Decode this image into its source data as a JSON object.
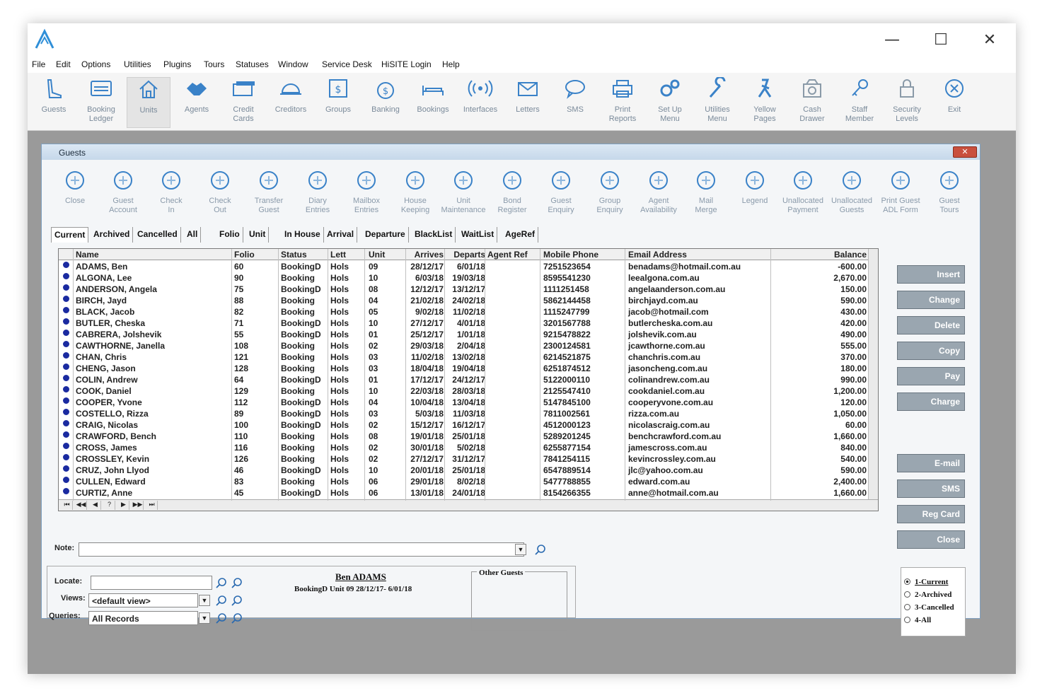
{
  "window": {
    "minimize": "—",
    "maximize": "☐",
    "close": "✕"
  },
  "menu": [
    "File",
    "Edit",
    "Options",
    "Utilities",
    "Plugins",
    "Tours",
    "Statuses",
    "Window",
    "Service Desk",
    "HiSITE Login",
    "Help"
  ],
  "toolbar": [
    {
      "label": "Guests",
      "icon": "guests-icon"
    },
    {
      "label": "Booking\nLedger",
      "icon": "ledger-icon"
    },
    {
      "label": "Units",
      "icon": "home-icon"
    },
    {
      "label": "Agents",
      "icon": "handshake-icon"
    },
    {
      "label": "Credit\nCards",
      "icon": "credit-card-icon"
    },
    {
      "label": "Creditors",
      "icon": "helmet-icon"
    },
    {
      "label": "Groups",
      "icon": "dollar-box-icon"
    },
    {
      "label": "Banking",
      "icon": "money-bag-icon"
    },
    {
      "label": "Bookings",
      "icon": "bed-icon"
    },
    {
      "label": "Interfaces",
      "icon": "broadcast-icon"
    },
    {
      "label": "Letters",
      "icon": "envelope-icon"
    },
    {
      "label": "SMS",
      "icon": "speech-bubble-icon"
    },
    {
      "label": "Print\nReports",
      "icon": "printer-icon"
    },
    {
      "label": "Set Up\nMenu",
      "icon": "gears-icon"
    },
    {
      "label": "Utilities\nMenu",
      "icon": "wrench-icon"
    },
    {
      "label": "Yellow\nPages",
      "icon": "walking-icon"
    },
    {
      "label": "Cash\nDrawer",
      "icon": "cash-drawer-icon"
    },
    {
      "label": "Staff\nMember",
      "icon": "key-icon"
    },
    {
      "label": "Security\nLevels",
      "icon": "lock-icon"
    },
    {
      "label": "Exit",
      "icon": "exit-circle-icon"
    }
  ],
  "guests": {
    "title": "Guests",
    "close_label": "✕",
    "toolbar": [
      {
        "label": "Close",
        "icon": "close-icon"
      },
      {
        "label": "Guest\nAccount",
        "icon": "guest-account-icon"
      },
      {
        "label": "Check\nIn",
        "icon": "check-in-icon"
      },
      {
        "label": "Check\nOut",
        "icon": "check-out-icon"
      },
      {
        "label": "Transfer\nGuest",
        "icon": "transfer-icon"
      },
      {
        "label": "Diary\nEntries",
        "icon": "diary-icon"
      },
      {
        "label": "Mailbox\nEntries",
        "icon": "mailbox-icon"
      },
      {
        "label": "House\nKeeping",
        "icon": "broom-icon"
      },
      {
        "label": "Unit\nMaintenance",
        "icon": "tools-icon"
      },
      {
        "label": "Bond\nRegister",
        "icon": "piggy-bank-icon"
      },
      {
        "label": "Guest\nEnquiry",
        "icon": "question-icon"
      },
      {
        "label": "Group\nEnquiry",
        "icon": "group-icon"
      },
      {
        "label": "Agent\nAvailability",
        "icon": "agent-icon"
      },
      {
        "label": "Mail\nMerge",
        "icon": "mail-merge-icon"
      },
      {
        "label": "Legend",
        "icon": "legend-icon"
      },
      {
        "label": "Unallocated\nPayment",
        "icon": "coins-icon"
      },
      {
        "label": "Unallocated\nGuests",
        "icon": "search-guest-icon"
      },
      {
        "label": "Print Guest\nADL Form",
        "icon": "print-form-icon"
      },
      {
        "label": "Guest\nTours",
        "icon": "bus-icon"
      }
    ],
    "tabs": [
      "Current",
      "Archived",
      "Cancelled",
      "All",
      "Folio",
      "Unit",
      "In House",
      "Arrival",
      "Departure",
      "BlackList",
      "WaitList",
      "AgeRef"
    ],
    "columns": [
      "Name",
      "Folio",
      "Status",
      "Lett",
      "Unit",
      "Arrives",
      "Departs",
      "Agent Ref",
      "Mobile Phone",
      "Email Address",
      "Balance"
    ],
    "rows": [
      [
        "ADAMS, Ben",
        "60",
        "BookingD",
        "Hols",
        "09",
        "28/12/17",
        "6/01/18",
        "",
        "7251523654",
        "benadams@hotmail.com.au",
        "-600.00"
      ],
      [
        "ALGONA, Lee",
        "90",
        "Booking",
        "Hols",
        "10",
        "6/03/18",
        "19/03/18",
        "",
        "8595541230",
        "leealgona.com.au",
        "2,670.00"
      ],
      [
        "ANDERSON, Angela",
        "75",
        "BookingD",
        "Hols",
        "08",
        "12/12/17",
        "13/12/17",
        "",
        "1111251458",
        "angelaanderson.com.au",
        "150.00"
      ],
      [
        "BIRCH, Jayd",
        "88",
        "Booking",
        "Hols",
        "04",
        "21/02/18",
        "24/02/18",
        "",
        "5862144458",
        "birchjayd.com.au",
        "590.00"
      ],
      [
        "BLACK, Jacob",
        "82",
        "Booking",
        "Hols",
        "05",
        "9/02/18",
        "11/02/18",
        "",
        "1115247799",
        "jacob@hotmail.com",
        "430.00"
      ],
      [
        "BUTLER, Cheska",
        "71",
        "BookingD",
        "Hols",
        "10",
        "27/12/17",
        "4/01/18",
        "",
        "3201567788",
        "butlercheska.com.au",
        "420.00"
      ],
      [
        "CABRERA, Jolshevik",
        "55",
        "BookingD",
        "Hols",
        "01",
        "25/12/17",
        "1/01/18",
        "",
        "9215478822",
        "jolshevik.com.au",
        "490.00"
      ],
      [
        "CAWTHORNE, Janella",
        "108",
        "Booking",
        "Hols",
        "02",
        "29/03/18",
        "2/04/18",
        "",
        "2300124581",
        "jcawthorne.com.au",
        "555.00"
      ],
      [
        "CHAN, Chris",
        "121",
        "Booking",
        "Hols",
        "03",
        "11/02/18",
        "13/02/18",
        "",
        "6214521875",
        "chanchris.com.au",
        "370.00"
      ],
      [
        "CHENG, Jason",
        "128",
        "Booking",
        "Hols",
        "03",
        "18/04/18",
        "19/04/18",
        "",
        "6251874512",
        "jasoncheng.com.au",
        "180.00"
      ],
      [
        "COLIN, Andrew",
        "64",
        "BookingD",
        "Hols",
        "01",
        "17/12/17",
        "24/12/17",
        "",
        "5122000110",
        "colinandrew.com.au",
        "990.00"
      ],
      [
        "COOK, Daniel",
        "129",
        "Booking",
        "Hols",
        "10",
        "22/03/18",
        "28/03/18",
        "",
        "2125547410",
        "cookdaniel.com.au",
        "1,200.00"
      ],
      [
        "COOPER, Yvone",
        "112",
        "BookingD",
        "Hols",
        "04",
        "10/04/18",
        "13/04/18",
        "",
        "5147845100",
        "cooperyvone.com.au",
        "120.00"
      ],
      [
        "COSTELLO, Rizza",
        "89",
        "BookingD",
        "Hols",
        "03",
        "5/03/18",
        "11/03/18",
        "",
        "7811002561",
        "rizza.com.au",
        "1,050.00"
      ],
      [
        "CRAIG, Nicolas",
        "100",
        "BookingD",
        "Hols",
        "02",
        "15/12/17",
        "16/12/17",
        "",
        "4512000123",
        "nicolascraig.com.au",
        "60.00"
      ],
      [
        "CRAWFORD, Bench",
        "110",
        "Booking",
        "Hols",
        "08",
        "19/01/18",
        "25/01/18",
        "",
        "5289201245",
        "benchcrawford.com.au",
        "1,660.00"
      ],
      [
        "CROSS, James",
        "116",
        "Booking",
        "Hols",
        "02",
        "30/01/18",
        "5/02/18",
        "",
        "6255877154",
        "jamescross.com.au",
        "840.00"
      ],
      [
        "CROSSLEY, Kevin",
        "126",
        "Booking",
        "Hols",
        "02",
        "27/12/17",
        "31/12/17",
        "",
        "7841254115",
        "kevincrossley.com.au",
        "540.00"
      ],
      [
        "CRUZ, John Llyod",
        "46",
        "BookingD",
        "Hols",
        "10",
        "20/01/18",
        "25/01/18",
        "",
        "6547889514",
        "jlc@yahoo.com.au",
        "590.00"
      ],
      [
        "CULLEN, Edward",
        "83",
        "Booking",
        "Hols",
        "06",
        "29/01/18",
        "8/02/18",
        "",
        "5477788855",
        "edward.com.au",
        "2,400.00"
      ],
      [
        "CURTIZ, Anne",
        "45",
        "BookingD",
        "Hols",
        "06",
        "13/01/18",
        "24/01/18",
        "",
        "8154266355",
        "anne@hotmail.com.au",
        "1,660.00"
      ]
    ],
    "nav": [
      "⏮",
      "◀◀",
      "◀",
      "?",
      "▶",
      "▶▶",
      "⏭"
    ],
    "buttons": {
      "insert": "Insert",
      "change": "Change",
      "delete": "Delete",
      "copy": "Copy",
      "pay": "Pay",
      "charge": "Charge",
      "email": "E-mail",
      "sms": "SMS",
      "reg_card": "Reg Card",
      "close": "Close"
    },
    "note_label": "Note:",
    "locate_label": "Locate:",
    "views_label": "Views:",
    "views_value": "<default view>",
    "queries_label": "Queries:",
    "queries_value": "All Records",
    "selected_guest": {
      "name": "Ben ADAMS",
      "detail": "BookingD Unit 09 28/12/17- 6/01/18"
    },
    "other_guests_label": "Other Guests",
    "radio_options": [
      "1-Current",
      "2-Archived",
      "3-Cancelled",
      "4-All"
    ],
    "radio_selected": "1-Current"
  },
  "colors": {
    "accent": "#2f8fd8",
    "icon": "#3a82c8",
    "bullet": "#1a2aa0",
    "side_button": "#9aa6b0"
  }
}
